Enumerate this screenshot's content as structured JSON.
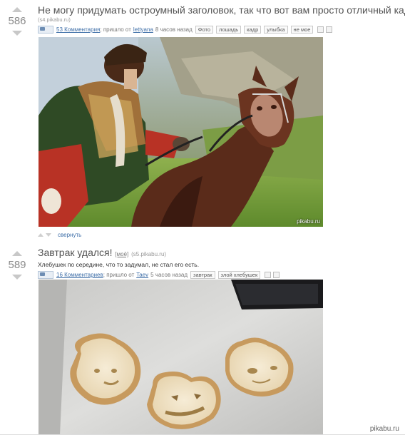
{
  "posts": [
    {
      "rating": "586",
      "title": "Не могу придумать остроумный заголовок, так что вот вам просто отличный кадр",
      "source": "(s4.pikabu.ru)",
      "comments": "53 Комментария",
      "came_from": "; пришло от",
      "author": "lettyana",
      "time": "8 часов назад",
      "tags": [
        "Фото",
        "лошадь",
        "кадр",
        "улыбка",
        "не мое"
      ],
      "image_watermark": "pikabu.ru",
      "collapse": "свернуть"
    },
    {
      "rating": "589",
      "title": "Завтрак удался!",
      "inline_tag": "[моё]",
      "source": "(s5.pikabu.ru)",
      "description": "Хлебушек по середине, что то задумал, не стал его есть.",
      "comments": "16 Комментариев",
      "came_from": "; пришло от",
      "author": "Taev",
      "time": "5 часов назад",
      "tags": [
        "завтрак",
        "злой хлебушек"
      ]
    }
  ],
  "footer_watermark": "pikabu.ru"
}
